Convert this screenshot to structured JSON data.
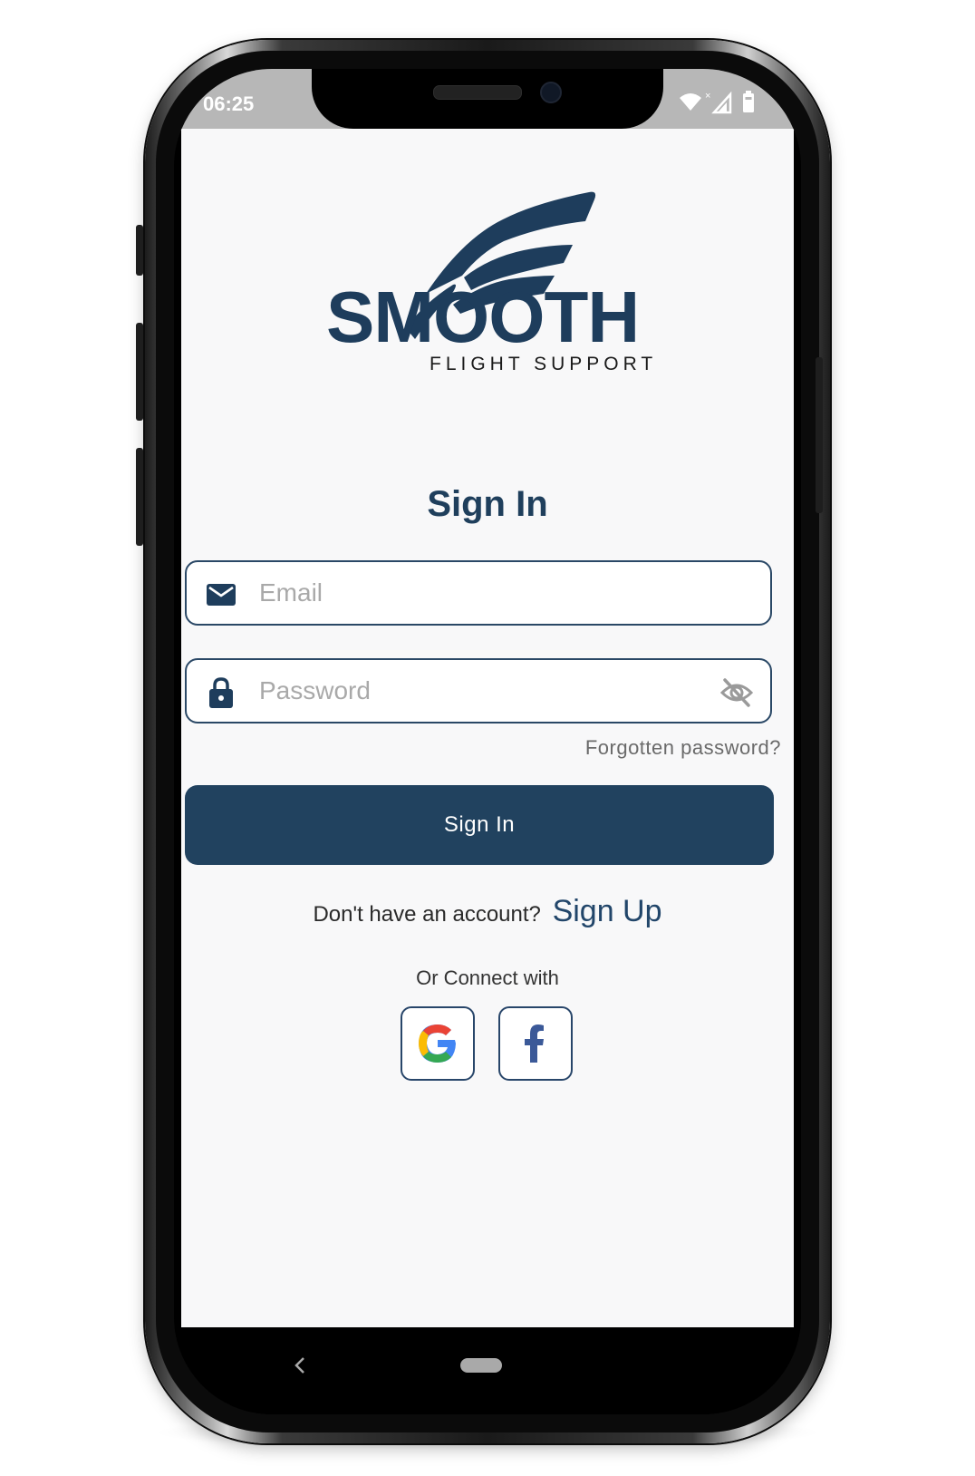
{
  "status_bar": {
    "time": "06:25",
    "icons": [
      "wifi-icon",
      "no-signal-icon",
      "battery-icon"
    ]
  },
  "brand": {
    "name": "SMOOTH",
    "tagline": "FLIGHT SUPPORT",
    "color": "#1e3d5c"
  },
  "screen": {
    "title": "Sign In"
  },
  "form": {
    "email_placeholder": "Email",
    "email_value": "",
    "password_placeholder": "Password",
    "password_value": "",
    "forgot_link": "Forgotten password?",
    "submit_label": "Sign In"
  },
  "signup": {
    "prompt": "Don't have an account?",
    "link": "Sign Up"
  },
  "social": {
    "heading": "Or Connect with",
    "providers": [
      "Google",
      "Facebook"
    ]
  },
  "nav": {
    "icons": [
      "back-icon",
      "home-pill-icon"
    ]
  },
  "colors": {
    "primary": "#21425f",
    "background": "#f8f8f9",
    "status_bar": "#b7b7b7",
    "placeholder": "#a9a9a9"
  }
}
